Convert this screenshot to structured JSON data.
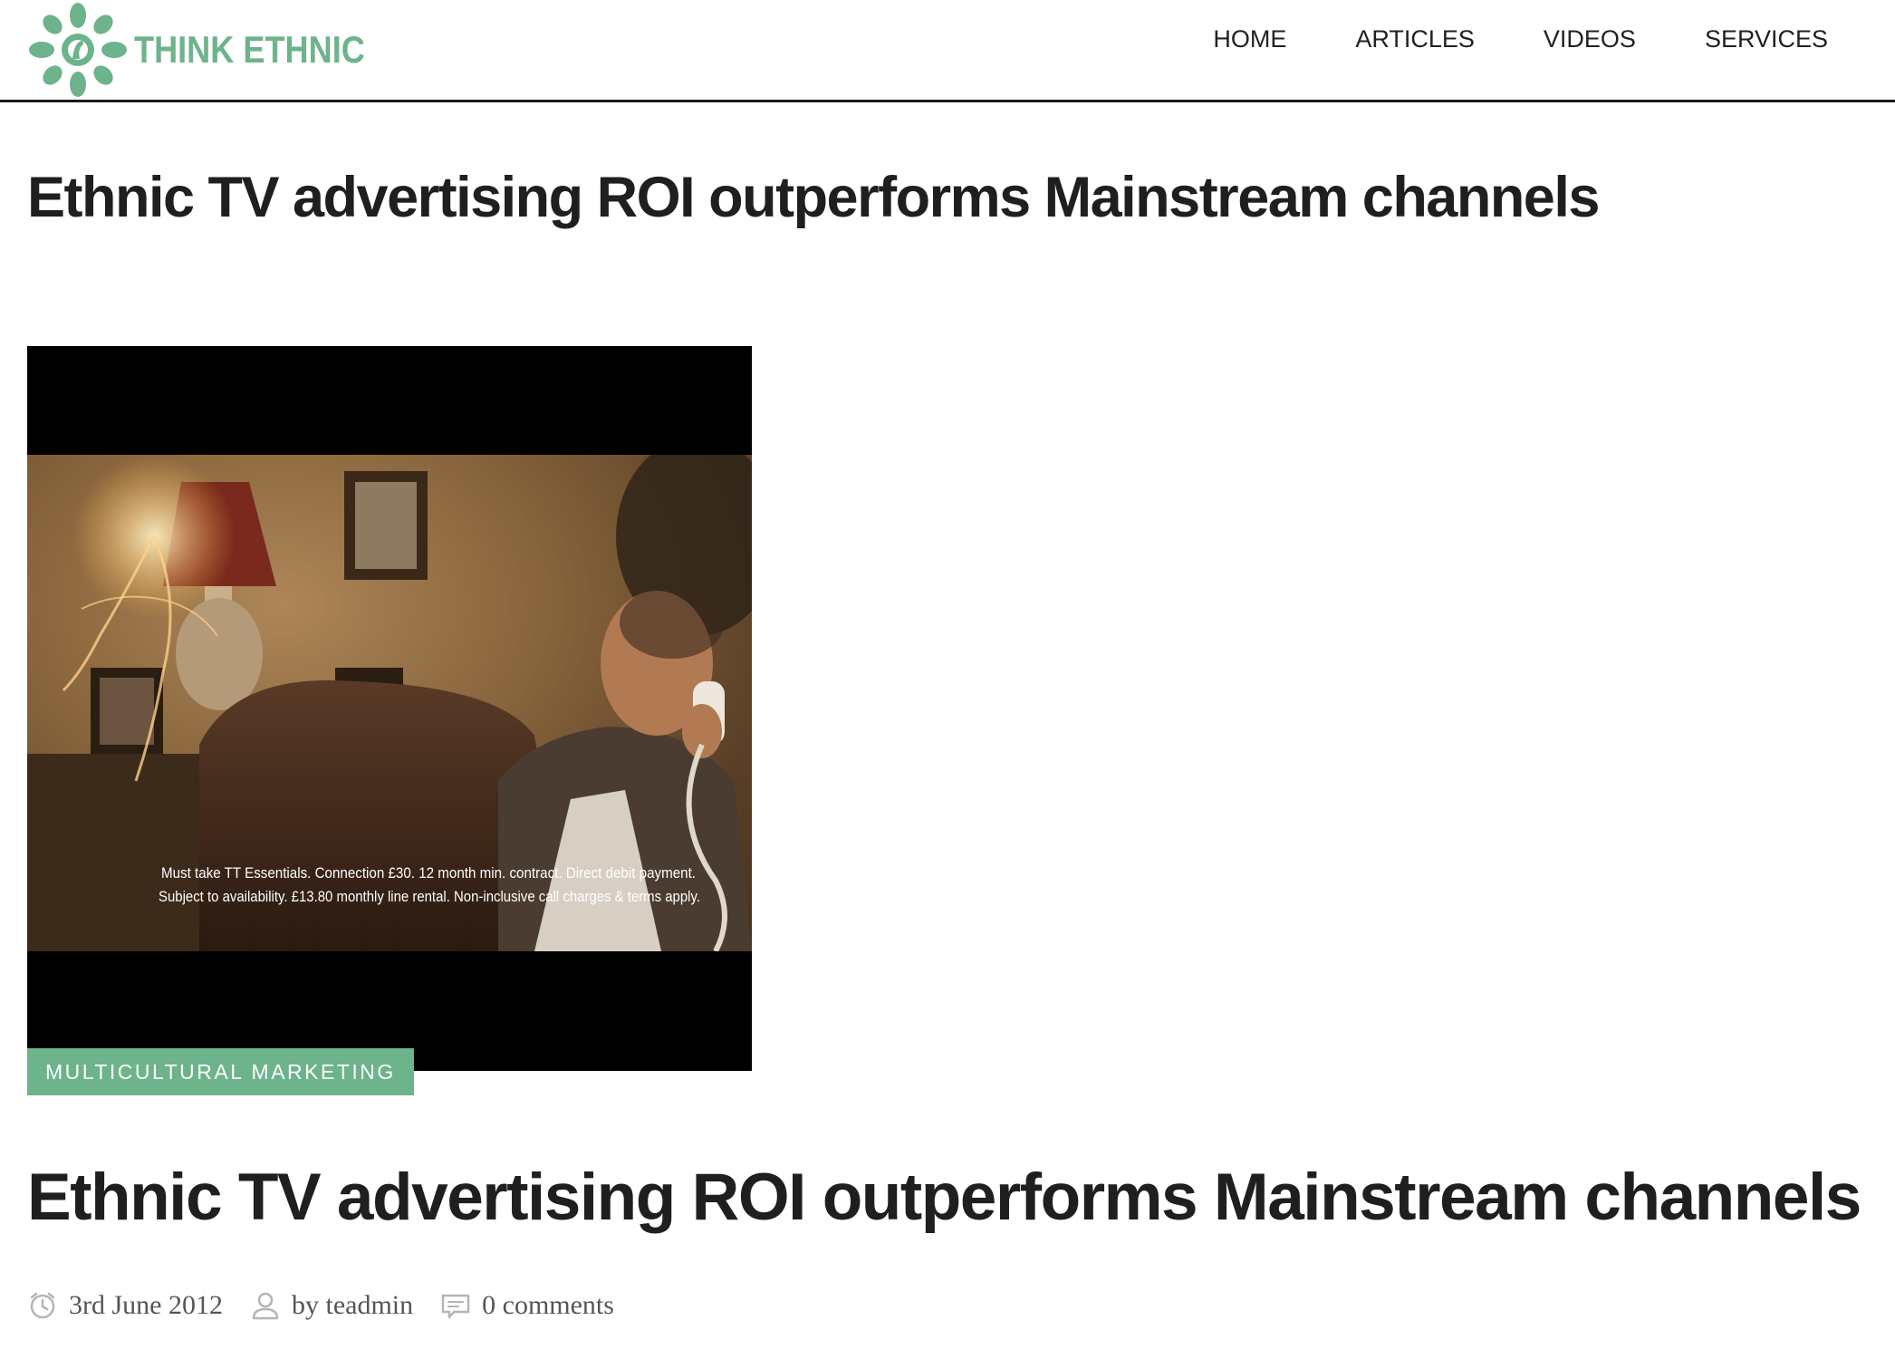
{
  "brand": {
    "name": "THINK ETHNIC",
    "color": "#6db38b"
  },
  "nav": {
    "items": [
      {
        "label": "HOME"
      },
      {
        "label": "ARTICLES"
      },
      {
        "label": "VIDEOS"
      },
      {
        "label": "SERVICES"
      }
    ]
  },
  "page": {
    "title": "Ethnic TV advertising ROI outperforms Mainstream channels"
  },
  "post": {
    "category": "MULTICULTURAL MARKETING",
    "title": "Ethnic TV advertising ROI outperforms Mainstream channels",
    "image": {
      "caption_line_1": "Must take TT Essentials. Connection £30. 12 month min. contract. Direct debit payment.",
      "caption_line_2": "Subject to availability. £13.80 monthly line rental. Non-inclusive call charges & terms apply."
    },
    "meta": {
      "date": "3rd June 2012",
      "author": "by teadmin",
      "comments": "0 comments"
    }
  },
  "icons": {
    "logo": "peacock-mandala-icon",
    "date": "clock-icon",
    "author": "user-icon",
    "comments": "comment-icon"
  }
}
